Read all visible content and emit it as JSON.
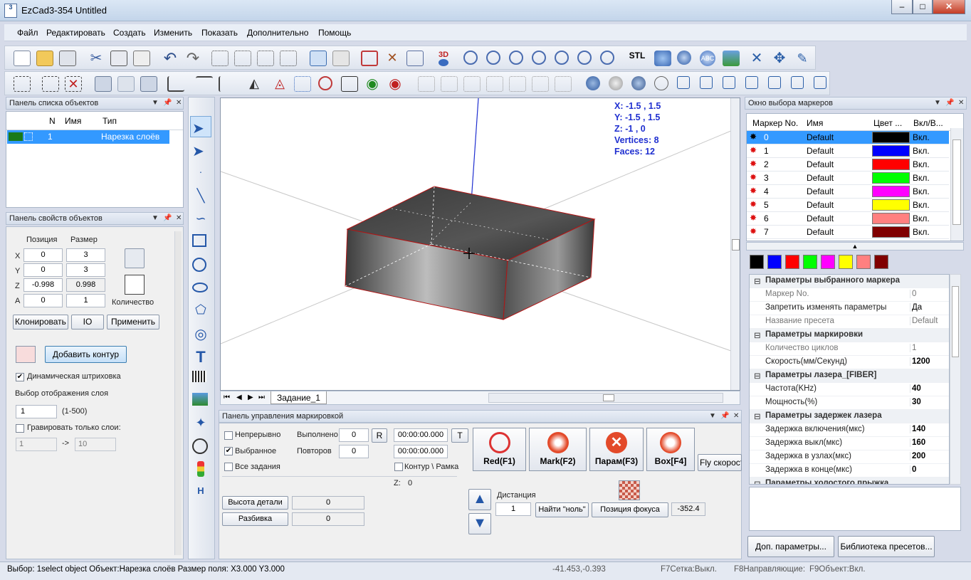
{
  "window": {
    "title": "EzCad3-354 Untitled",
    "icon_text": "3",
    "min": "–",
    "max": "□",
    "close": "✕"
  },
  "menu": [
    "Файл",
    "Редактировать",
    "Создать",
    "Изменить",
    "Показать",
    "Дополнительно",
    "Помощь"
  ],
  "toolbar": {
    "stl": "STL",
    "three_d": "3D"
  },
  "object_list": {
    "title": "Панель списка объектов",
    "col_n": "N",
    "col_name": "Имя",
    "col_type": "Тип",
    "row": {
      "n": "1",
      "name": "",
      "type": "Нарезка слоёв"
    }
  },
  "props": {
    "title": "Панель свойств объектов",
    "pos_label": "Позиция",
    "size_label": "Размер",
    "x_label": "X",
    "y_label": "Y",
    "z_label": "Z",
    "a_label": "A",
    "x_pos": "0",
    "y_pos": "0",
    "z_pos": "-0.998",
    "a_pos": "0",
    "x_size": "3",
    "y_size": "3",
    "z_size": "0.998",
    "a_count": "1",
    "count_label": "Количество",
    "clone": "Клонировать",
    "io": "IO",
    "apply": "Применить",
    "add_contour": "Добавить контур",
    "dyn_hatch": "Динамическая штриховка",
    "layer_display": "Выбор отображения слоя",
    "layer_value": "1",
    "layer_range": "(1-500)",
    "engrave_only": "Гравировать только слои:",
    "from": "1",
    "arrow": "->",
    "to": "10"
  },
  "viewport": {
    "info": [
      "X: -1.5 , 1.5",
      "Y: -1.5 , 1.5",
      "Z: -1 , 0",
      "Vertices: 8",
      "Faces: 12"
    ],
    "tab": "Задание_1"
  },
  "mark_panel": {
    "title": "Панель управления маркировкой",
    "continuous": "Непрерывно",
    "selected": "Выбранное",
    "all_tasks": "Все задания",
    "done_label": "Выполнено",
    "done_value": "0",
    "r_btn": "R",
    "time1": "00:00:00.000",
    "t_btn": "T",
    "repeat_label": "Повторов",
    "repeat_value": "0",
    "time2": "00:00:00.000",
    "contour_frame": "Контур \\ Рамка",
    "red": "Red(F1)",
    "mark": "Mark(F2)",
    "param": "Парам(F3)",
    "box": "Box[F4]",
    "fly": "Fly скорость",
    "z_label": "Z:",
    "z_value": "0",
    "part_height": "Высота детали",
    "part_height_value": "0",
    "split": "Разбивка",
    "split_value": "0",
    "distance": "Дистанция",
    "distance_value": "1",
    "find_zero": "Найти \"ноль\"",
    "focus_pos": "Позиция фокуса",
    "focus_value": "-352.4"
  },
  "markers": {
    "title": "Окно выбора маркеров",
    "col_no": "Маркер No.",
    "col_name": "Имя",
    "col_color": "Цвет ...",
    "col_on": "Вкл/В...",
    "rows": [
      {
        "no": "0",
        "name": "Default",
        "color": "#000000",
        "on": "Вкл."
      },
      {
        "no": "1",
        "name": "Default",
        "color": "#0000ff",
        "on": "Вкл."
      },
      {
        "no": "2",
        "name": "Default",
        "color": "#ff0000",
        "on": "Вкл."
      },
      {
        "no": "3",
        "name": "Default",
        "color": "#00ff00",
        "on": "Вкл."
      },
      {
        "no": "4",
        "name": "Default",
        "color": "#ff00ff",
        "on": "Вкл."
      },
      {
        "no": "5",
        "name": "Default",
        "color": "#ffff00",
        "on": "Вкл."
      },
      {
        "no": "6",
        "name": "Default",
        "color": "#ff8080",
        "on": "Вкл."
      },
      {
        "no": "7",
        "name": "Default",
        "color": "#800000",
        "on": "Вкл."
      }
    ],
    "swatches": [
      "#000000",
      "#0000ff",
      "#ff0000",
      "#00ff00",
      "#ff00ff",
      "#ffff00",
      "#ff8080",
      "#800000"
    ]
  },
  "marker_props": [
    {
      "cat": "Параметры выбранного маркера"
    },
    {
      "k": "Маркер No.",
      "v": "0",
      "dim": true
    },
    {
      "k": "Запретить изменять параметры",
      "v": "Да"
    },
    {
      "k": "Название пресета",
      "v": "Default",
      "dim": true
    },
    {
      "cat": "Параметры маркировки"
    },
    {
      "k": "Количество циклов",
      "v": "1",
      "dim": true
    },
    {
      "k": "Скорость(мм/Секунд)",
      "v": "1200",
      "bold": true
    },
    {
      "cat": "Параметры лазера_[FIBER]"
    },
    {
      "k": "Частота(KHz)",
      "v": "40",
      "bold": true
    },
    {
      "k": "Мощность(%)",
      "v": "30",
      "bold": true
    },
    {
      "cat": "Параметры задержек лазера"
    },
    {
      "k": "Задержка включения(мкс)",
      "v": "140",
      "bold": true
    },
    {
      "k": "Задержка выкл(мкс)",
      "v": "160",
      "bold": true
    },
    {
      "k": "Задержка в узлах(мкс)",
      "v": "200",
      "bold": true
    },
    {
      "k": "Задержка в конце(мкс)",
      "v": "0",
      "bold": true
    },
    {
      "cat": "Параметры холостого прыжка"
    }
  ],
  "marker_buttons": {
    "more": "Доп. параметры...",
    "library": "Библиотека пресетов..."
  },
  "status": {
    "left": "Выбор: 1select object Объект:Нарезка слоёв Размер поля: X3.000 Y3.000",
    "coords": "-41.453,-0.393",
    "grid": "F7Сетка:Выкл.",
    "guides": "F8Направляющие:",
    "obj": "F9Объект:Вкл."
  }
}
